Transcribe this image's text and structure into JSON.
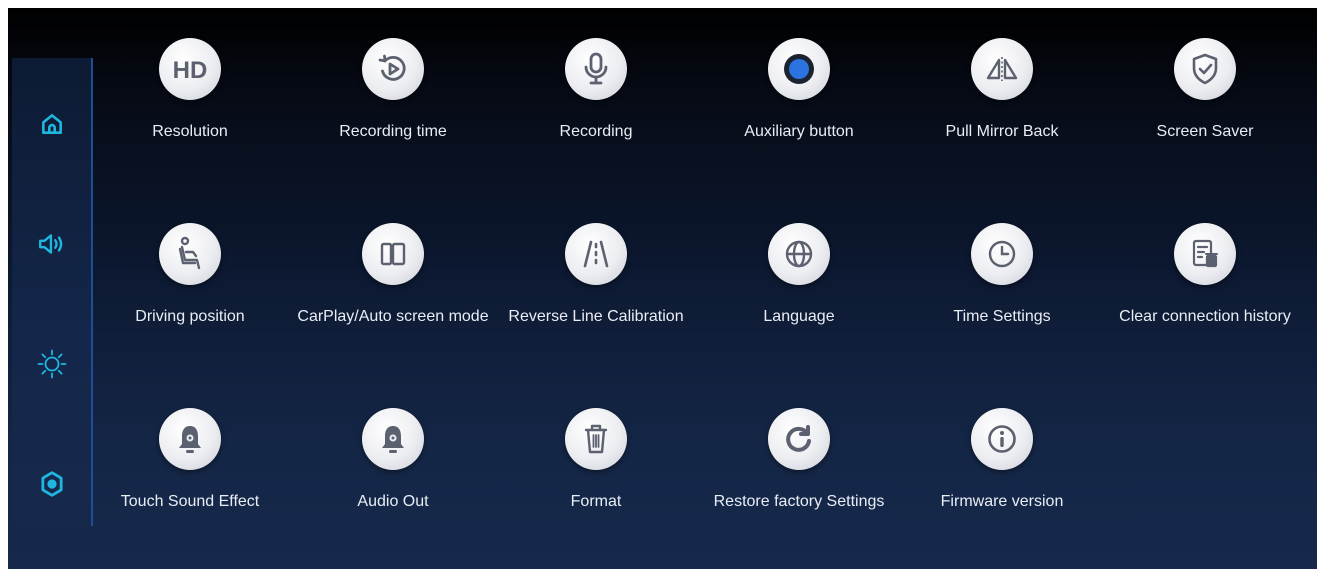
{
  "colors": {
    "accent": "#1fb6e0",
    "icon_fill": "#5c6170",
    "tile_circle": "#eceef2",
    "label": "#e9edf5",
    "sidebar_border": "#1f4e99",
    "background_top": "#000000",
    "background_bottom": "#17294b"
  },
  "sidebar": {
    "items": [
      {
        "icon": "home-icon",
        "selected": false
      },
      {
        "icon": "speaker-icon",
        "selected": false
      },
      {
        "icon": "brightness-icon",
        "selected": false
      },
      {
        "icon": "settings-hex-icon",
        "selected": true
      }
    ]
  },
  "settings": {
    "row1": [
      {
        "icon": "hd-icon",
        "label": "Resolution"
      },
      {
        "icon": "replay-icon",
        "label": "Recording time"
      },
      {
        "icon": "microphone-icon",
        "label": "Recording"
      },
      {
        "icon": "record-dot-icon",
        "label": "Auxiliary button"
      },
      {
        "icon": "mirror-icon",
        "label": "Pull Mirror Back"
      },
      {
        "icon": "shield-check-icon",
        "label": "Screen Saver"
      }
    ],
    "row2": [
      {
        "icon": "seat-icon",
        "label": "Driving position"
      },
      {
        "icon": "screen-split-icon",
        "label": "CarPlay/Auto screen mode"
      },
      {
        "icon": "reverse-lines-icon",
        "label": "Reverse Line Calibration"
      },
      {
        "icon": "globe-icon",
        "label": "Language"
      },
      {
        "icon": "clock-icon",
        "label": "Time Settings"
      },
      {
        "icon": "clear-history-icon",
        "label": "Clear connection history"
      }
    ],
    "row3": [
      {
        "icon": "bell-icon",
        "label": "Touch Sound Effect"
      },
      {
        "icon": "bell-icon",
        "label": "Audio Out"
      },
      {
        "icon": "trash-icon",
        "label": "Format"
      },
      {
        "icon": "restore-icon",
        "label": "Restore factory Settings"
      },
      {
        "icon": "info-icon",
        "label": "Firmware version"
      }
    ]
  }
}
